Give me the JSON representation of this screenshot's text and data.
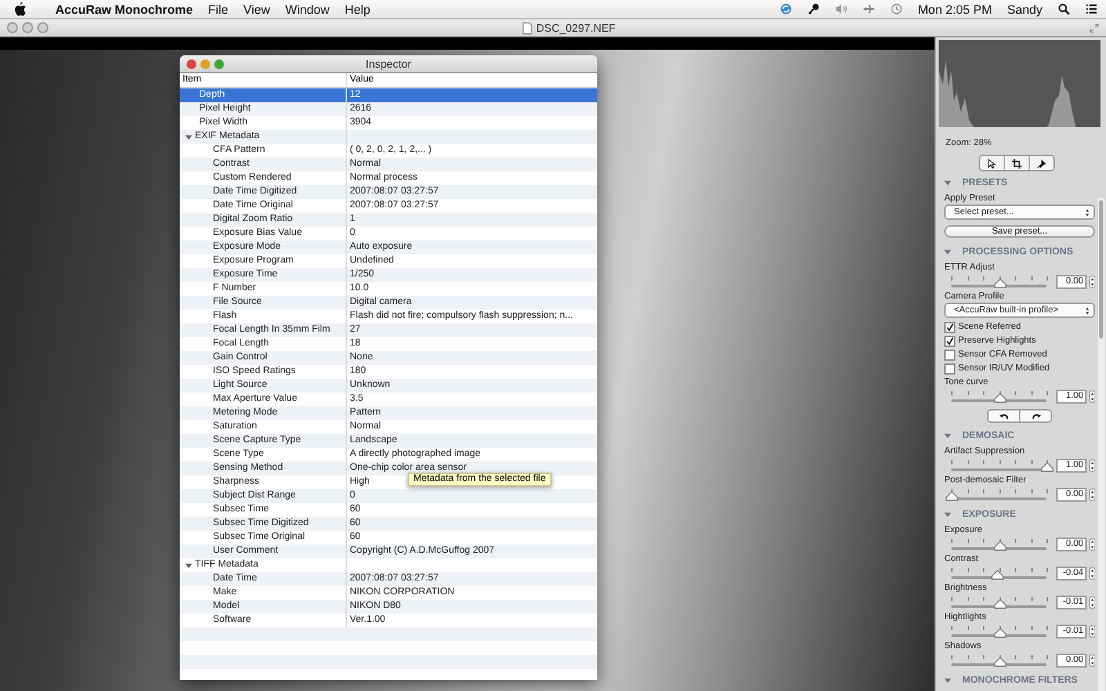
{
  "menubar": {
    "app_name": "AccuRaw Monochrome",
    "menus": [
      "File",
      "View",
      "Window",
      "Help"
    ],
    "clock": "Mon 2:05 PM",
    "user": "Sandy"
  },
  "window": {
    "title": "DSC_0297.NEF"
  },
  "inspector": {
    "title": "Inspector",
    "columns": [
      "Item",
      "Value"
    ],
    "tooltip": "Metadata from the selected file",
    "rows": [
      {
        "item": "Depth",
        "value": "12",
        "selected": true
      },
      {
        "item": "Pixel Height",
        "value": "2616",
        "selected": false
      },
      {
        "item": "Pixel Width",
        "value": "3904",
        "selected": false
      },
      {
        "item": "EXIF Metadata",
        "selected": false,
        "expanded": true,
        "children": [
          {
            "item": "CFA Pattern",
            "value": "( 0, 2, 0, 2, 1, 2,... )",
            "selected": false
          },
          {
            "item": "Contrast",
            "value": "Normal",
            "selected": false
          },
          {
            "item": "Custom Rendered",
            "value": "Normal process",
            "selected": false
          },
          {
            "item": "Date Time Digitized",
            "value": "2007:08:07 03:27:57",
            "selected": false
          },
          {
            "item": "Date Time Original",
            "value": "2007:08:07 03:27:57",
            "selected": false
          },
          {
            "item": "Digital Zoom Ratio",
            "value": "1",
            "selected": false
          },
          {
            "item": "Exposure Bias Value",
            "value": "0",
            "selected": false
          },
          {
            "item": "Exposure Mode",
            "value": "Auto exposure",
            "selected": false
          },
          {
            "item": "Exposure Program",
            "value": "Undefined",
            "selected": false
          },
          {
            "item": "Exposure Time",
            "value": "1/250",
            "selected": false
          },
          {
            "item": "F Number",
            "value": "10.0",
            "selected": false
          },
          {
            "item": "File Source",
            "value": "Digital camera",
            "selected": false
          },
          {
            "item": "Flash",
            "value": "Flash did not fire; compulsory flash suppression; n...",
            "selected": false
          },
          {
            "item": "Focal Length In 35mm Film",
            "value": "27",
            "selected": false
          },
          {
            "item": "Focal Length",
            "value": "18",
            "selected": false
          },
          {
            "item": "Gain Control",
            "value": "None",
            "selected": false
          },
          {
            "item": "ISO Speed Ratings",
            "value": "180",
            "selected": false
          },
          {
            "item": "Light Source",
            "value": "Unknown",
            "selected": false
          },
          {
            "item": "Max Aperture Value",
            "value": "3.5",
            "selected": false
          },
          {
            "item": "Metering Mode",
            "value": "Pattern",
            "selected": false
          },
          {
            "item": "Saturation",
            "value": "Normal",
            "selected": false
          },
          {
            "item": "Scene Capture Type",
            "value": "Landscape",
            "selected": false
          },
          {
            "item": "Scene Type",
            "value": "A directly photographed image",
            "selected": false
          },
          {
            "item": "Sensing Method",
            "value": "One-chip color area sensor",
            "selected": false
          },
          {
            "item": "Sharpness",
            "value": "High",
            "selected": false
          },
          {
            "item": "Subject Dist Range",
            "value": "0",
            "selected": false
          },
          {
            "item": "Subsec Time",
            "value": "60",
            "selected": false
          },
          {
            "item": "Subsec Time Digitized",
            "value": "60",
            "selected": false
          },
          {
            "item": "Subsec Time Original",
            "value": "60",
            "selected": false
          },
          {
            "item": "User Comment",
            "value": "Copyright (C) A.D.McGuffog 2007",
            "selected": false
          }
        ]
      },
      {
        "item": "TIFF Metadata",
        "selected": false,
        "expanded": true,
        "children": [
          {
            "item": "Date Time",
            "value": "2007:08:07 03:27:57",
            "selected": false
          },
          {
            "item": "Make",
            "value": "NIKON CORPORATION",
            "selected": false
          },
          {
            "item": "Model",
            "value": "NIKON D80",
            "selected": false
          },
          {
            "item": "Software",
            "value": "Ver.1.00",
            "selected": false
          }
        ]
      }
    ]
  },
  "panel": {
    "zoom": "Zoom: 28%",
    "sections": [
      {
        "title": "PRESETS",
        "expanded": true,
        "controls": [
          {
            "kind": "select",
            "label": "Apply Preset",
            "value": "Select preset..."
          },
          {
            "kind": "button",
            "label": "Save preset..."
          }
        ]
      },
      {
        "title": "PROCESSING OPTIONS",
        "expanded": true,
        "controls": [
          {
            "kind": "slider",
            "label": "ETTR Adjust",
            "level": 0.5,
            "value": "0.00"
          },
          {
            "kind": "select",
            "label": "Camera Profile",
            "value": "<AccuRaw built-in profile>"
          },
          {
            "kind": "checkbox",
            "label": "Scene Referred",
            "checked": true
          },
          {
            "kind": "checkbox",
            "label": "Preserve Highlights",
            "checked": true
          },
          {
            "kind": "checkbox",
            "label": "Sensor CFA Removed",
            "checked": false
          },
          {
            "kind": "checkbox",
            "label": "Sensor IR/UV Modified",
            "checked": false
          },
          {
            "kind": "slider",
            "label": "Tone curve",
            "level": 0.5,
            "value": "1.00"
          },
          {
            "kind": "rotate"
          }
        ]
      },
      {
        "title": "DEMOSAIC",
        "expanded": true,
        "controls": [
          {
            "kind": "slider",
            "label": "Artifact Suppression",
            "level": 1,
            "value": "1.00"
          },
          {
            "kind": "slider",
            "label": "Post-demosaic Filter",
            "level": 0,
            "value": "0.00"
          }
        ]
      },
      {
        "title": "EXPOSURE",
        "expanded": true,
        "controls": [
          {
            "kind": "slider",
            "label": "Exposure",
            "level": 0.5,
            "value": "0.00"
          },
          {
            "kind": "slider",
            "label": "Contrast",
            "level": 0.48,
            "value": "-0.04"
          },
          {
            "kind": "slider",
            "label": "Brightness",
            "level": 0.5,
            "value": "-0.01"
          },
          {
            "kind": "slider",
            "label": "Hightlights",
            "level": 0.5,
            "value": "-0.01"
          },
          {
            "kind": "slider",
            "label": "Shadows",
            "level": 0.5,
            "value": "0.00"
          }
        ]
      },
      {
        "title": "MONOCHROME FILTERS",
        "expanded": true
      }
    ]
  }
}
